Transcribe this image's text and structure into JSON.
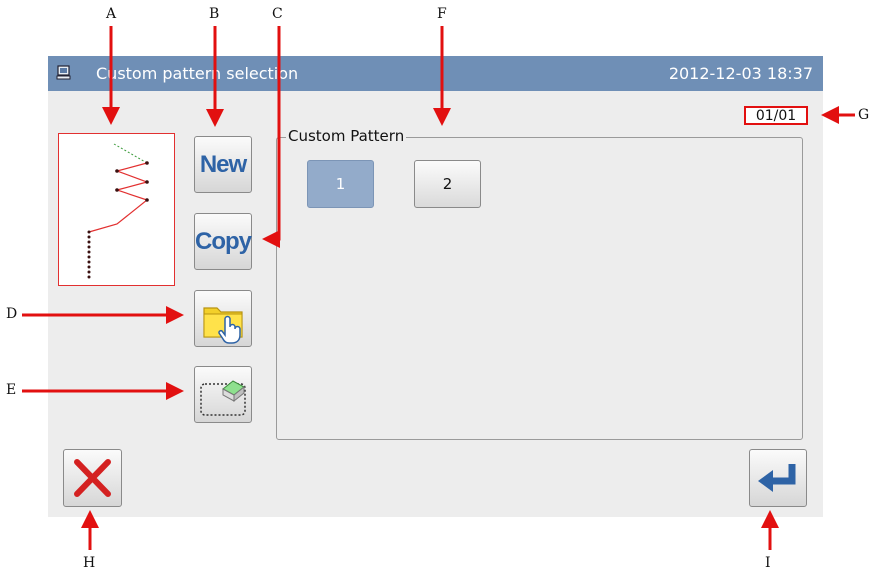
{
  "callouts": {
    "A": "A",
    "B": "B",
    "C": "C",
    "D": "D",
    "E": "E",
    "F": "F",
    "G": "G",
    "H": "H",
    "I": "I"
  },
  "titlebar": {
    "title": "Custom pattern selection",
    "datetime": "2012-12-03  18:37",
    "icon": "monitor-icon"
  },
  "toolbar": {
    "new_label": "New",
    "copy_label": "Copy",
    "open_icon": "folder-hand-icon",
    "erase_icon": "eraser-icon"
  },
  "page_indicator": "01/01",
  "group": {
    "title": "Custom Pattern",
    "patterns": [
      "1",
      "2"
    ],
    "selected": "1"
  },
  "bottom": {
    "cancel_icon": "close-icon",
    "confirm_icon": "enter-icon"
  },
  "colors": {
    "titlebar": "#6f8fb6",
    "selected_pattern": "#93abca",
    "callout_arrow": "#e21010",
    "cancel": "#d42121",
    "confirm": "#2e63a6"
  }
}
